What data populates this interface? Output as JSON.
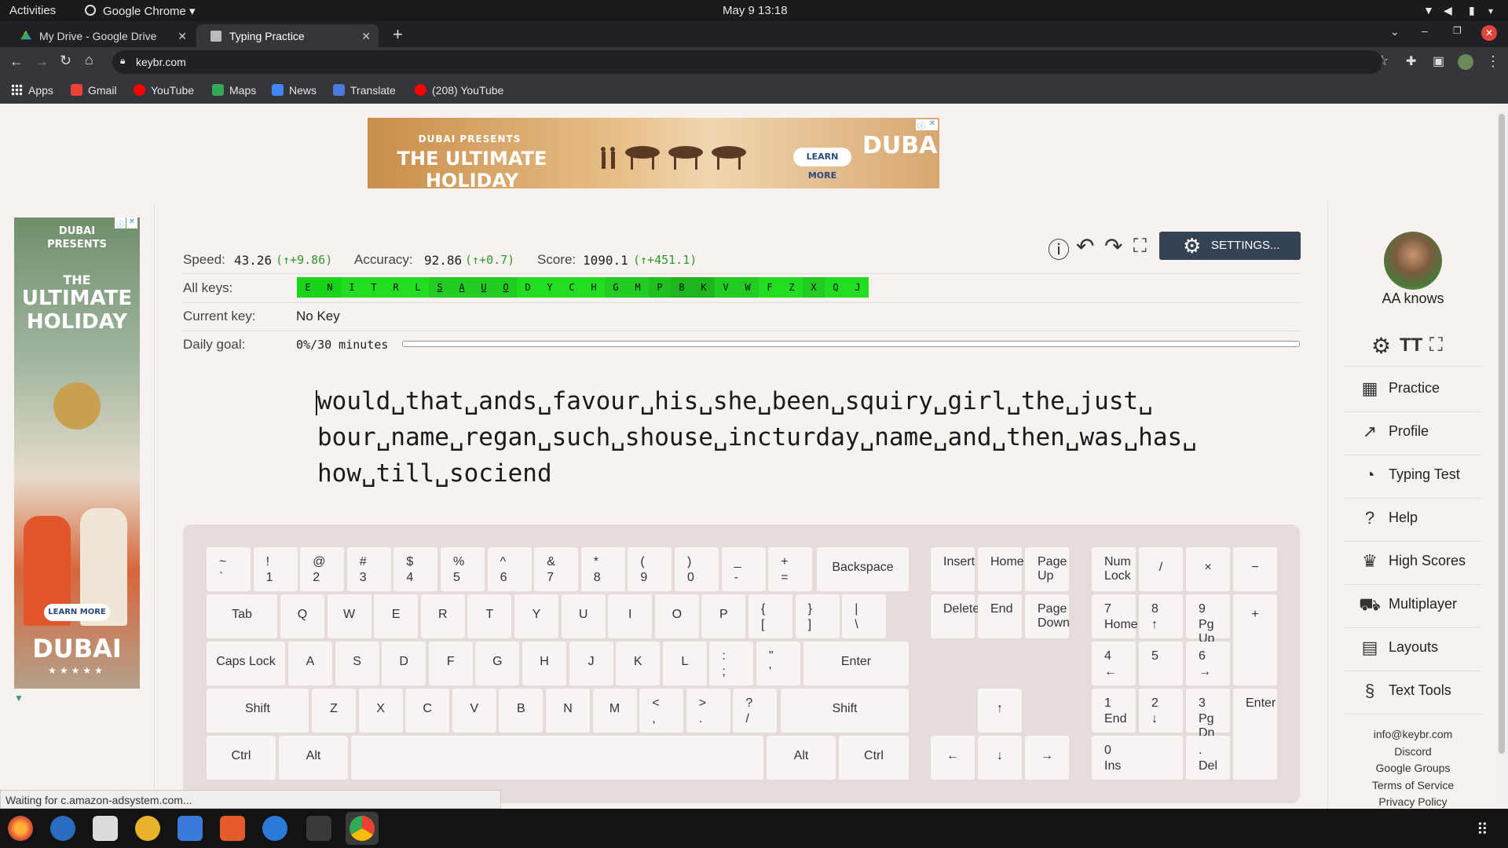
{
  "system": {
    "activities": "Activities",
    "app": "Google Chrome ▾",
    "clock": "May 9  13:18"
  },
  "tabs": [
    {
      "title": "My Drive - Google Drive",
      "close": "✕"
    },
    {
      "title": "Typing Practice",
      "close": "✕"
    }
  ],
  "new_tab": "+",
  "address": {
    "url": "keybr.com"
  },
  "bookmarks": [
    "Apps",
    "Gmail",
    "YouTube",
    "Maps",
    "News",
    "Translate",
    "(208) YouTube"
  ],
  "top_ad": {
    "line1": "DUBAI PRESENTS",
    "line2": "THE ULTIMATE HOLIDAY",
    "cta": "LEARN MORE",
    "brand": "DUBAI"
  },
  "side_ad": {
    "line1": "DUBAI",
    "line2": "PRESENTS",
    "line3": "THE",
    "line4": "ULTIMATE",
    "line5": "HOLIDAY",
    "cta": "LEARN MORE",
    "brand": "DUBAI"
  },
  "stats": {
    "speed_label": "Speed:",
    "speed_value": "43.26",
    "speed_delta": "(↑+9.86)",
    "accuracy_label": "Accuracy:",
    "accuracy_value": "92.86",
    "accuracy_delta": "(↑+0.7)",
    "score_label": "Score:",
    "score_value": "1090.1",
    "score_delta": "(↑+451.1)"
  },
  "all_keys_label": "All keys:",
  "all_keys": [
    {
      "k": "E",
      "color": "#1ad41a"
    },
    {
      "k": "N",
      "color": "#1ad41a"
    },
    {
      "k": "I",
      "color": "#22dd22"
    },
    {
      "k": "T",
      "color": "#22dd22"
    },
    {
      "k": "R",
      "color": "#22dd22"
    },
    {
      "k": "L",
      "color": "#22dd22"
    },
    {
      "k": "S",
      "color": "#22cc22",
      "u": true
    },
    {
      "k": "A",
      "color": "#22cc22",
      "u": true
    },
    {
      "k": "U",
      "color": "#22cc22",
      "u": true
    },
    {
      "k": "O",
      "color": "#22cc22",
      "u": true
    },
    {
      "k": "D",
      "color": "#22dd22"
    },
    {
      "k": "Y",
      "color": "#22dd22"
    },
    {
      "k": "C",
      "color": "#22dd22"
    },
    {
      "k": "H",
      "color": "#22dd22"
    },
    {
      "k": "G",
      "color": "#22cc22"
    },
    {
      "k": "M",
      "color": "#22cc22"
    },
    {
      "k": "P",
      "color": "#1fbf1f"
    },
    {
      "k": "B",
      "color": "#1fb51f"
    },
    {
      "k": "K",
      "color": "#1fb51f"
    },
    {
      "k": "V",
      "color": "#22cc22"
    },
    {
      "k": "W",
      "color": "#22cc22"
    },
    {
      "k": "F",
      "color": "#22dd22"
    },
    {
      "k": "Z",
      "color": "#22dd22"
    },
    {
      "k": "X",
      "color": "#22cc22"
    },
    {
      "k": "Q",
      "color": "#22dd22"
    },
    {
      "k": "J",
      "color": "#22dd22"
    }
  ],
  "current_key_label": "Current key:",
  "current_key": "No Key",
  "daily_goal_label": "Daily goal:",
  "daily_goal": "0%/30 minutes",
  "daily_goal_progress": 0,
  "practice_text": [
    "would␣that␣ands␣favour␣his␣she␣been␣squiry␣girl␣the␣just␣",
    "bour␣name␣regan␣such␣shouse␣incturday␣name␣and␣then␣was␣has␣",
    "how␣till␣sociend"
  ],
  "settings_label": "SETTINGS...",
  "user": {
    "name": "AA knows"
  },
  "nav": [
    "Practice",
    "Profile",
    "Typing Test",
    "Help",
    "High Scores",
    "Multiplayer",
    "Layouts",
    "Text Tools"
  ],
  "footer": [
    "info@keybr.com",
    "Discord",
    "Google Groups",
    "Terms of Service",
    "Privacy Policy"
  ],
  "status": "Waiting for c.amazon-adsystem.com...",
  "keyboard": {
    "rows": [
      [
        [
          "~",
          "`"
        ],
        [
          "!",
          "1"
        ],
        [
          "@",
          "2"
        ],
        [
          "#",
          "3"
        ],
        [
          "$",
          "4"
        ],
        [
          "%",
          "5"
        ],
        [
          "^",
          "6"
        ],
        [
          "&",
          "7"
        ],
        [
          "*",
          "8"
        ],
        [
          "(",
          "9"
        ],
        [
          ")",
          "0"
        ],
        [
          "_",
          "-"
        ],
        [
          "+",
          "="
        ]
      ],
      [
        [
          "Q"
        ],
        [
          "W"
        ],
        [
          "E"
        ],
        [
          "R"
        ],
        [
          "T"
        ],
        [
          "Y"
        ],
        [
          "U"
        ],
        [
          "I"
        ],
        [
          "O"
        ],
        [
          "P"
        ],
        [
          "{",
          "["
        ],
        [
          "}",
          "]"
        ],
        [
          "|",
          "\\"
        ]
      ],
      [
        [
          "A"
        ],
        [
          "S"
        ],
        [
          "D"
        ],
        [
          "F"
        ],
        [
          "G"
        ],
        [
          "H"
        ],
        [
          "J"
        ],
        [
          "K"
        ],
        [
          "L"
        ],
        [
          ":",
          ";"
        ],
        [
          "\"",
          "'"
        ]
      ],
      [
        [
          "Z"
        ],
        [
          "X"
        ],
        [
          "C"
        ],
        [
          "V"
        ],
        [
          "B"
        ],
        [
          "N"
        ],
        [
          "M"
        ],
        [
          "<",
          ","
        ],
        [
          ">",
          "."
        ],
        [
          "?",
          "/"
        ]
      ]
    ],
    "backspace": "Backspace",
    "tab": "Tab",
    "caps": "Caps Lock",
    "enter": "Enter",
    "shift": "Shift",
    "ctrl": "Ctrl",
    "alt": "Alt",
    "insert": "Insert",
    "home": "Home",
    "pageup": "Page Up",
    "delete": "Delete",
    "end": "End",
    "pagedown": "Page Down",
    "arrows": {
      "up": "↑",
      "left": "←",
      "down": "↓",
      "right": "→"
    },
    "numpad": {
      "numlock": "Num Lock",
      "div": "/",
      "mul": "×",
      "minus": "−",
      "plus": "+",
      "enter": "Enter",
      "n7": [
        "7",
        "Home"
      ],
      "n8": [
        "8",
        "↑"
      ],
      "n9": [
        "9",
        "Pg Up"
      ],
      "n4": [
        "4",
        "←"
      ],
      "n5": [
        "5",
        ""
      ],
      "n6": [
        "6",
        "→"
      ],
      "n1": [
        "1",
        "End"
      ],
      "n2": [
        "2",
        "↓"
      ],
      "n3": [
        "3",
        "Pg Dn"
      ],
      "n0": [
        "0",
        "Ins"
      ],
      "dot": [
        ".",
        "Del"
      ]
    }
  }
}
